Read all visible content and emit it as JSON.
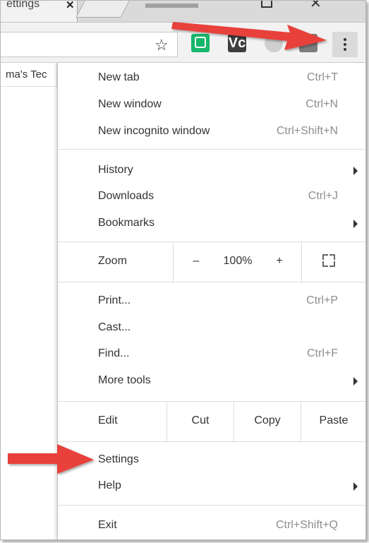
{
  "window": {
    "tab_title": "ettings",
    "tab_close": "✕"
  },
  "toolbar": {
    "star_icon": "☆",
    "ext_dark_label": "Vc"
  },
  "page": {
    "bookmark_text": "ma's Tec"
  },
  "menu": {
    "new_tab": {
      "label": "New tab",
      "shortcut": "Ctrl+T"
    },
    "new_window": {
      "label": "New window",
      "shortcut": "Ctrl+N"
    },
    "new_incognito": {
      "label": "New incognito window",
      "shortcut": "Ctrl+Shift+N"
    },
    "history": {
      "label": "History"
    },
    "downloads": {
      "label": "Downloads",
      "shortcut": "Ctrl+J"
    },
    "bookmarks": {
      "label": "Bookmarks"
    },
    "zoom": {
      "label": "Zoom",
      "minus": "–",
      "value": "100%",
      "plus": "+"
    },
    "print": {
      "label": "Print...",
      "shortcut": "Ctrl+P"
    },
    "cast": {
      "label": "Cast..."
    },
    "find": {
      "label": "Find...",
      "shortcut": "Ctrl+F"
    },
    "more_tools": {
      "label": "More tools"
    },
    "edit": {
      "label": "Edit",
      "cut": "Cut",
      "copy": "Copy",
      "paste": "Paste"
    },
    "settings": {
      "label": "Settings"
    },
    "help": {
      "label": "Help"
    },
    "exit": {
      "label": "Exit",
      "shortcut": "Ctrl+Shift+Q"
    }
  },
  "colors": {
    "arrow_red": "#e8403a",
    "extension_green": "#18b66b"
  }
}
